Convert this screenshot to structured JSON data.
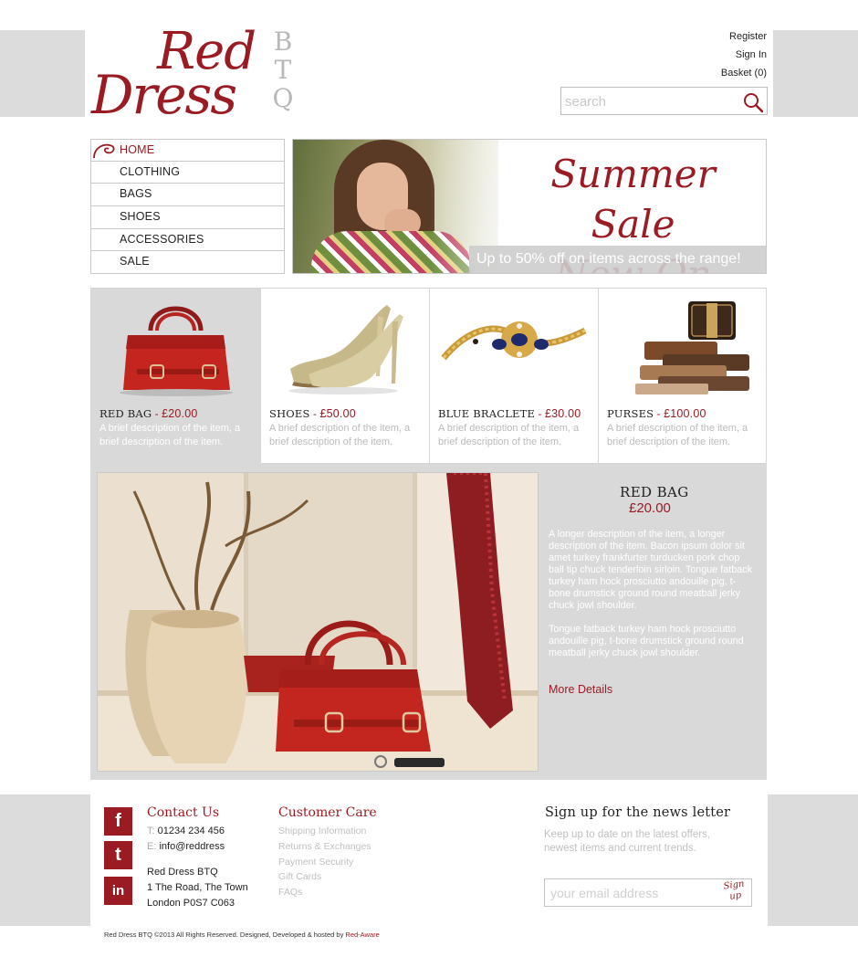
{
  "brand": {
    "word1": "Red",
    "word2": "Dress",
    "btq": [
      "B",
      "T",
      "Q"
    ],
    "primary_color": "#9b1b23",
    "grey_band_color": "#dcdcdc"
  },
  "account": {
    "register": "Register",
    "sign_in": "Sign In",
    "basket": "Basket (0)"
  },
  "search": {
    "placeholder": "search",
    "icon": "search-icon"
  },
  "nav": {
    "items": [
      {
        "label": "HOME",
        "active": true
      },
      {
        "label": "CLOTHING"
      },
      {
        "label": "BAGS"
      },
      {
        "label": "SHOES"
      },
      {
        "label": "ACCESSORIES"
      },
      {
        "label": "SALE"
      }
    ]
  },
  "banner": {
    "line1": "Summer Sale",
    "line2": "Now On",
    "caption": "Up to 50% off on items across the range!"
  },
  "products": [
    {
      "name": "RED BAG",
      "price": "£20.00",
      "desc": "A brief description of the item, a brief description of the item.",
      "active": true
    },
    {
      "name": "SHOES",
      "price": "£50.00",
      "desc": "A brief description of the item, a brief description of the item."
    },
    {
      "name": "BLUE BRACLETE",
      "price": "£30.00",
      "desc": "A brief description of the item, a brief description of the item."
    },
    {
      "name": "PURSES",
      "price": "£100.00",
      "desc": "A brief description of the item, a brief description of the item."
    }
  ],
  "feature": {
    "title": "RED BAG",
    "price": "£20.00",
    "para1": "A longer description of the item, a longer description of the item. Bacon ipsum dolor sit amet turkey frankfurter turducken pork chop ball tip chuck tenderloin sirloin. Tongue fatback turkey ham hock prosciutto andouille pig, t-bone drumstick ground round meatball jerky chuck jowl shoulder.",
    "para2": "Tongue fatback turkey ham hock prosciutto andouille pig, t-bone drumstick ground round meatball jerky chuck jowl shoulder.",
    "more": "More Details"
  },
  "footer": {
    "social": [
      {
        "icon": "facebook-icon",
        "glyph": "f"
      },
      {
        "icon": "twitter-icon",
        "glyph": "t"
      },
      {
        "icon": "linkedin-icon",
        "glyph": "in"
      }
    ],
    "contact": {
      "heading": "Contact Us",
      "phone_label": "T:",
      "phone": "01234 234 456",
      "email_label": "E:",
      "email": "info@reddress",
      "address1": "Red Dress BTQ",
      "address2": "1 The Road, The Town",
      "address3": "London P0S7 C063"
    },
    "care": {
      "heading": "Customer Care",
      "links": [
        "Shipping Information",
        "Returns & Exchanges",
        "Payment Security",
        "Gift Cards",
        "FAQs"
      ]
    },
    "newsletter": {
      "heading": "Sign up for the news letter",
      "text": "Keep up to date on the latest offers, newest items and current trends.",
      "placeholder": "your email address",
      "button_line1": "Sign",
      "button_line2": "up"
    }
  },
  "copyright": {
    "text": "Red Dress BTQ ©2013 All Rights Reserved. Designed, Developed & hosted by ",
    "link": "Red-Aware"
  }
}
